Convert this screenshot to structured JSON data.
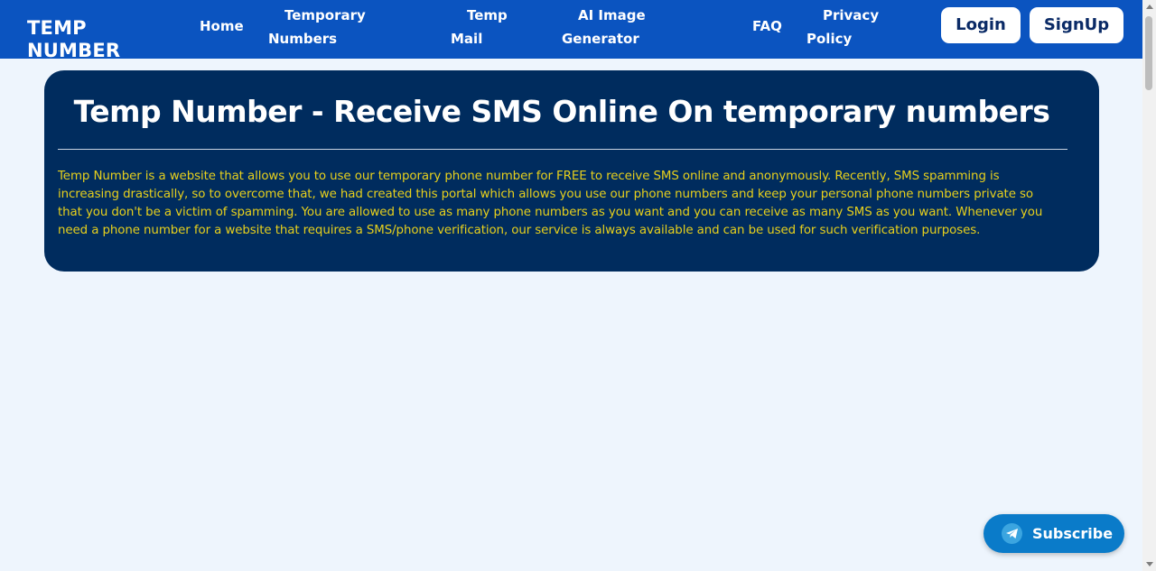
{
  "brand": {
    "line1": "TEMP",
    "line2": "NUMBER"
  },
  "nav": {
    "home": "Home",
    "temporary_numbers": {
      "line1": "Temporary",
      "line2": "Numbers"
    },
    "temp_mail": {
      "line1": "Temp",
      "line2": "Mail"
    },
    "ai_image_generator": {
      "line1": "AI Image",
      "line2": "Generator"
    },
    "faq": "FAQ",
    "privacy_policy": {
      "line1": "Privacy",
      "line2": "Policy"
    }
  },
  "auth": {
    "login": "Login",
    "signup": "SignUp"
  },
  "hero": {
    "title": "Temp Number - Receive SMS Online On temporary numbers",
    "description": "Temp Number is a website that allows you to use our temporary phone number for FREE to receive SMS online and anonymously. Recently, SMS spamming is increasing drastically, so to overcome that, we had created this portal which allows you use our phone numbers and keep your personal phone numbers private so that you don't be a victim of spamming. You are allowed to use as many phone numbers as you want and you can receive as many SMS as you want. Whenever you need a phone number for a website that requires a SMS/phone verification, our service is always available and can be used for such verification purposes."
  },
  "subscribe": {
    "label": "Subscribe",
    "icon": "telegram-icon"
  },
  "colors": {
    "navbar": "#0b54c0",
    "page_bg": "#eef5fd",
    "hero_bg": "#002c5e",
    "hero_text": "#e7d01c",
    "subscribe_bg": "#0a7bc9"
  }
}
